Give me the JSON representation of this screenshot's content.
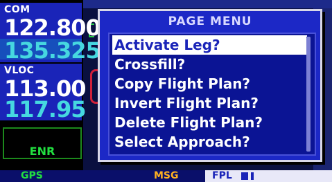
{
  "radios": {
    "com": {
      "label": "COM",
      "active": "122.800",
      "standby": "135.325"
    },
    "vloc": {
      "label": "VLOC",
      "active": "113.00",
      "standby": "117.95"
    }
  },
  "cdi": {
    "mode": "ENR"
  },
  "popup": {
    "title": "PAGE MENU",
    "items": [
      "Activate Leg?",
      "Crossfill?",
      "Copy Flight Plan?",
      "Invert Flight Plan?",
      "Delete Flight Plan?",
      "Select Approach?"
    ],
    "selected_index": 0
  },
  "status_bar": {
    "gps": "GPS",
    "msg": "MSG",
    "page": "FPL"
  },
  "colors": {
    "window_blue": "#1a24b8",
    "standby_cyan": "#46d8e0",
    "gps_green": "#22e040",
    "msg_amber": "#ffb020"
  }
}
